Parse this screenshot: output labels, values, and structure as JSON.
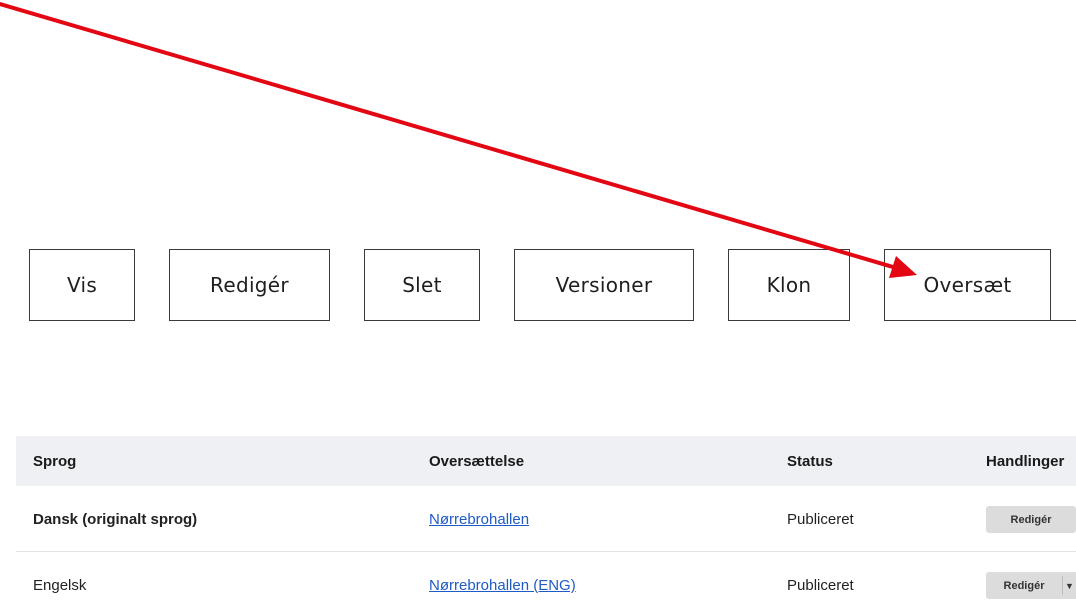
{
  "tabs": [
    {
      "label": "Vis"
    },
    {
      "label": "Redigér"
    },
    {
      "label": "Slet"
    },
    {
      "label": "Versioner"
    },
    {
      "label": "Klon"
    },
    {
      "label": "Oversæt"
    }
  ],
  "translations_table": {
    "headers": {
      "language": "Sprog",
      "translation": "Oversættelse",
      "status": "Status",
      "actions": "Handlinger"
    },
    "rows": [
      {
        "language": "Dansk (originalt sprog)",
        "translation": "Nørrebrohallen",
        "status": "Publiceret",
        "action": "Redigér"
      },
      {
        "language": "Engelsk",
        "translation": "Nørrebrohallen (ENG)",
        "status": "Publiceret",
        "action": "Redigér"
      }
    ]
  },
  "annotation": {
    "shape": "arrow",
    "color": "#e30613",
    "points_to": "tab-oversaet"
  },
  "colors": {
    "link": "#1e5bc6",
    "table_header_bg": "#eef0f4",
    "button_bg": "#dcdcdc"
  }
}
